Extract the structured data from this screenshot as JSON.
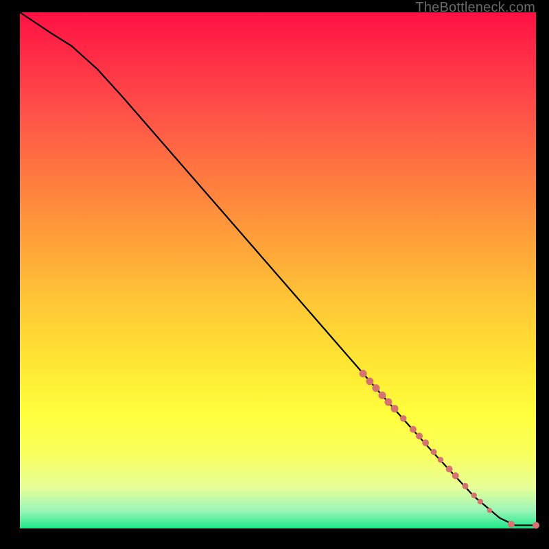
{
  "watermark": "TheBottleneck.com",
  "colors": {
    "background": "#000000",
    "marker": "#d6736e",
    "curve": "#000000"
  },
  "chart_data": {
    "type": "line",
    "title": "",
    "xlabel": "",
    "ylabel": "",
    "xlim": [
      0,
      100
    ],
    "ylim": [
      0,
      100
    ],
    "grid": false,
    "legend": false,
    "series": [
      {
        "name": "bottleneck-curve",
        "x": [
          0,
          3,
          6,
          10,
          15,
          20,
          30,
          40,
          50,
          60,
          70,
          80,
          88,
          93,
          96,
          100
        ],
        "y": [
          100,
          98,
          96,
          93.5,
          89,
          83.5,
          72,
          60.5,
          49,
          37.5,
          26,
          14.8,
          6.2,
          2.0,
          0.6,
          0.6
        ]
      }
    ],
    "markers": [
      {
        "x": 66.5,
        "y": 30.0,
        "r": 5.5
      },
      {
        "x": 67.8,
        "y": 28.5,
        "r": 5.5
      },
      {
        "x": 69.0,
        "y": 27.2,
        "r": 5.5
      },
      {
        "x": 70.2,
        "y": 25.8,
        "r": 5.5
      },
      {
        "x": 71.4,
        "y": 24.5,
        "r": 5.5
      },
      {
        "x": 72.6,
        "y": 23.2,
        "r": 5.5
      },
      {
        "x": 74.3,
        "y": 21.3,
        "r": 4.8
      },
      {
        "x": 76.2,
        "y": 19.2,
        "r": 5.0
      },
      {
        "x": 77.4,
        "y": 17.9,
        "r": 5.0
      },
      {
        "x": 78.6,
        "y": 16.6,
        "r": 5.0
      },
      {
        "x": 80.2,
        "y": 14.8,
        "r": 4.5
      },
      {
        "x": 81.5,
        "y": 13.3,
        "r": 4.2
      },
      {
        "x": 83.2,
        "y": 11.5,
        "r": 5.0
      },
      {
        "x": 84.4,
        "y": 10.2,
        "r": 5.0
      },
      {
        "x": 86.3,
        "y": 8.2,
        "r": 4.5
      },
      {
        "x": 88.0,
        "y": 6.4,
        "r": 4.2
      },
      {
        "x": 89.2,
        "y": 5.2,
        "r": 4.2
      },
      {
        "x": 91.0,
        "y": 3.5,
        "r": 3.8
      },
      {
        "x": 95.2,
        "y": 0.8,
        "r": 5.0
      },
      {
        "x": 100.0,
        "y": 0.6,
        "r": 5.0
      }
    ]
  }
}
